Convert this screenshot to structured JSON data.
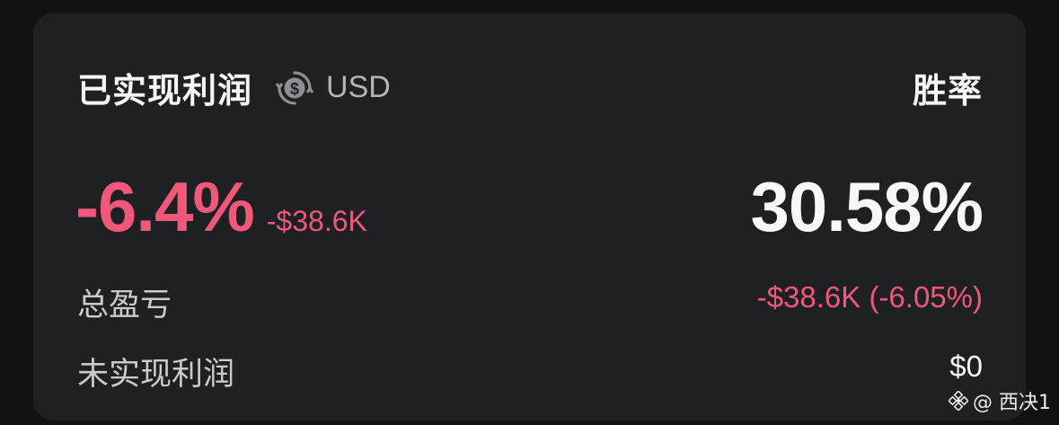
{
  "header": {
    "title": "已实现利润",
    "currency_icon": "currency-exchange-dollar-icon",
    "currency": "USD",
    "win_rate_label": "胜率"
  },
  "pnl": {
    "percent": "-6.4%",
    "amount": "-$38.6K"
  },
  "win_rate": {
    "value": "30.58%"
  },
  "rows": {
    "total": {
      "label": "总盈亏",
      "value": "-$38.6K (-6.05%)"
    },
    "unrealized": {
      "label": "未实现利润",
      "value": "$0"
    }
  },
  "watermark": {
    "text": "@ 西决1"
  },
  "colors": {
    "negative": "#f0587a",
    "card_bg": "#1f2024",
    "page_bg": "#111213",
    "text_primary": "#f4f5f6",
    "text_secondary": "#c9cbcf"
  }
}
